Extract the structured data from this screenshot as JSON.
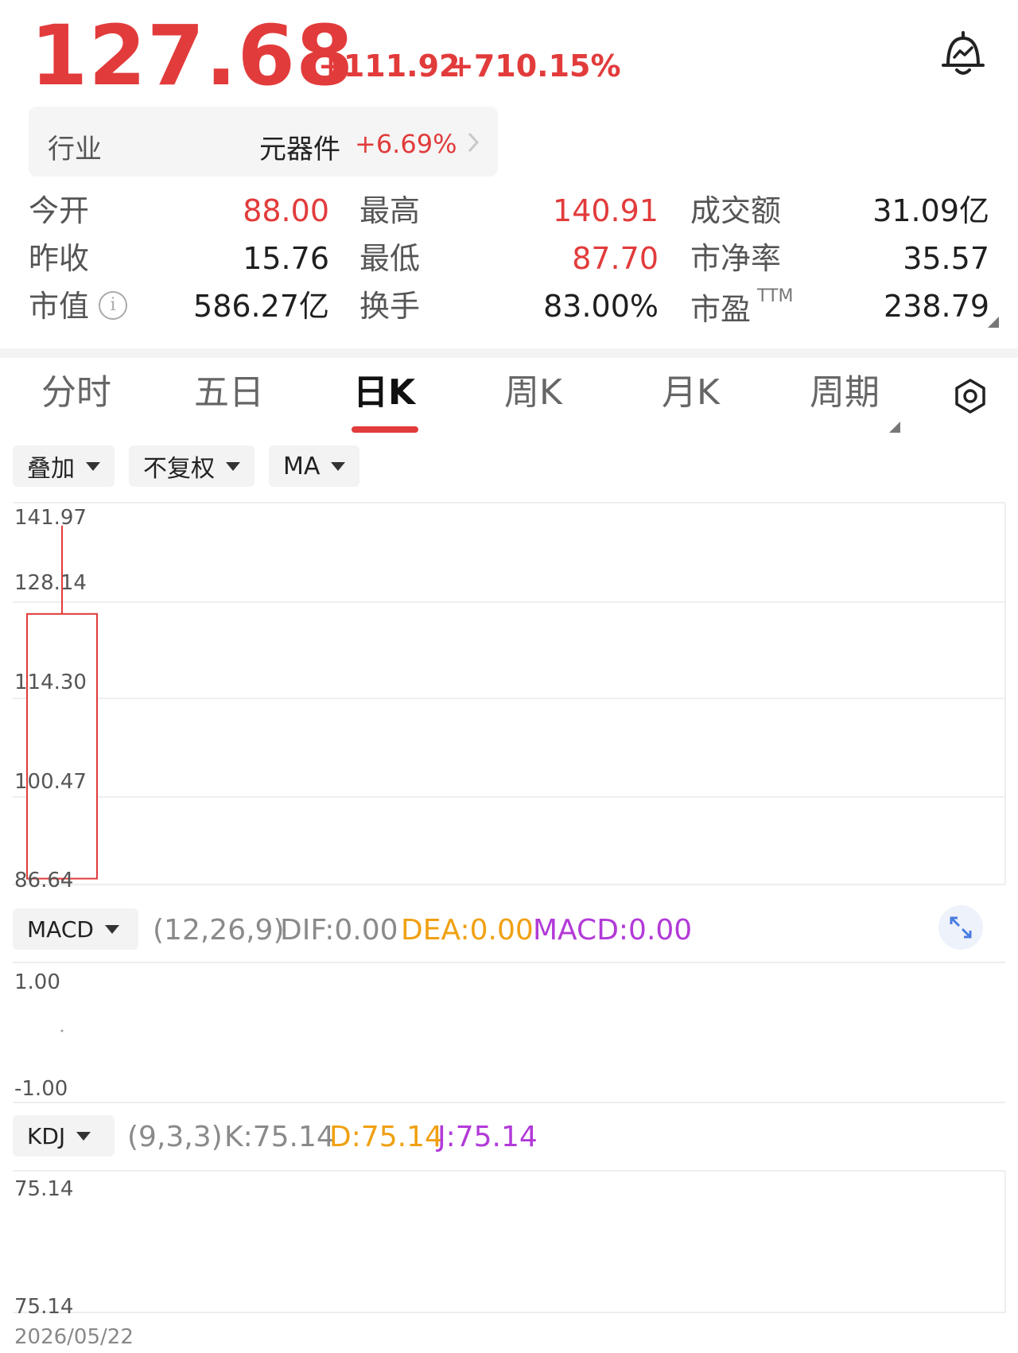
{
  "header": {
    "price": "127.68",
    "change": "+111.92",
    "change_pct": "+710.15%",
    "bell_icon": "bell-alert-icon"
  },
  "industry": {
    "label": "行业",
    "name": "元器件",
    "pct": "+6.69%"
  },
  "stats": {
    "open_label": "今开",
    "open": "88.00",
    "prev_close_label": "昨收",
    "prev_close": "15.76",
    "mcap_label": "市值",
    "mcap": "586.27亿",
    "high_label": "最高",
    "high": "140.91",
    "low_label": "最低",
    "low": "87.70",
    "turnover_label": "换手",
    "turnover": "83.00%",
    "amount_label": "成交额",
    "amount": "31.09亿",
    "pb_label": "市净率",
    "pb": "35.57",
    "pe_label": "市盈",
    "pe_sup": "TTM",
    "pe": "238.79",
    "info_glyph": "i"
  },
  "tabs": [
    "分时",
    "五日",
    "日K",
    "周K",
    "月K",
    "周期"
  ],
  "chips": {
    "overlay": "叠加",
    "adjust": "不复权",
    "ma": "MA"
  },
  "price_axis": [
    "141.97",
    "128.14",
    "114.30",
    "100.47",
    "86.64"
  ],
  "macd": {
    "chip": "MACD",
    "params": "(12,26,9)",
    "dif": "DIF:0.00",
    "dea": "DEA:0.00",
    "macd": "MACD:0.00",
    "axis_top": "1.00",
    "axis_bottom": "-1.00"
  },
  "kdj": {
    "chip": "KDJ",
    "params": "(9,3,3)",
    "k": "K:75.14",
    "d": "D:75.14",
    "j": "J:75.14",
    "axis_top": "75.14",
    "axis_bottom": "75.14"
  },
  "date": "2026/05/22",
  "colors": {
    "up": "#e23b3b",
    "dea": "#f0a012",
    "macd": "#b23ad8"
  },
  "chart_data": {
    "type": "candlestick",
    "ylim": [
      86.64,
      141.97
    ],
    "candles": [
      {
        "date": "2026/05/22",
        "open": 88.0,
        "close": 127.68,
        "high": 140.91,
        "low": 87.7
      }
    ]
  }
}
